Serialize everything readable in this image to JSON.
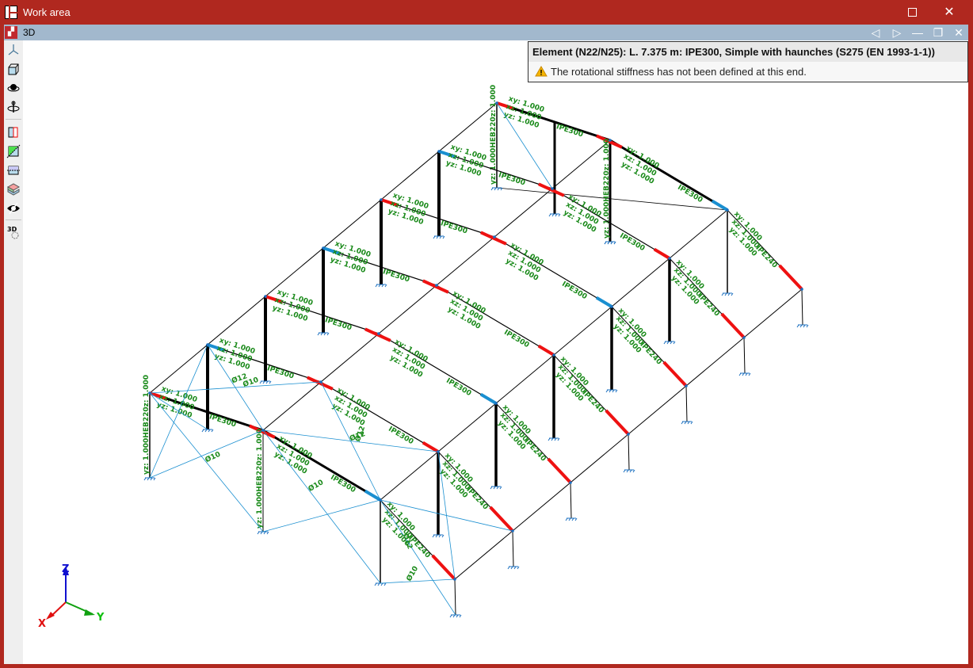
{
  "window": {
    "title": "Work area",
    "maximize_icon": "maximize-icon",
    "close_icon": "close-icon"
  },
  "view": {
    "title": "3D",
    "buttons": [
      "previous-icon",
      "next-icon",
      "minimize-icon",
      "restore-icon",
      "close-icon"
    ]
  },
  "toolbar": {
    "items": [
      "axes-icon",
      "cube-view-icon",
      "orbit-icon",
      "rotate-axis-icon",
      "section-red-icon",
      "section-green-icon",
      "section-blue-icon",
      "layers-icon",
      "hide-icon",
      "3d-settings-icon"
    ]
  },
  "tooltip": {
    "title": "Element (N22/N25): L. 7.375 m: IPE300, Simple with haunches (S275 (EN 1993-1-1))",
    "message": "The rotational stiffness has not been defined at this end."
  },
  "labels": {
    "xy": "xy: 1.000",
    "xz": "xz: 1.000",
    "yz": "yz: 1.000",
    "rafter_main": "IPE300",
    "rafter_leanto": "IPE240",
    "column": "HEB220",
    "brace_a": "Ø12",
    "brace_b": "Ø10"
  },
  "axes": {
    "x": "X",
    "y": "Y",
    "z": "Z"
  },
  "colors": {
    "frame": "#b0281f",
    "subbar": "#a2b8cd",
    "label": "#1a8a1a",
    "haunch": "#ee1111",
    "brace": "#1a8fd0"
  }
}
